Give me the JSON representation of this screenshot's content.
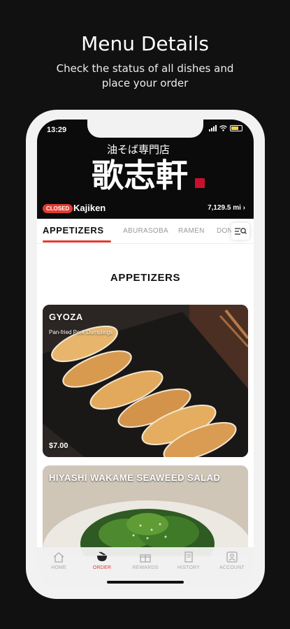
{
  "promo": {
    "title": "Menu Details",
    "subtitle": "Check the status of all dishes and place your order"
  },
  "status_bar": {
    "time": "13:29",
    "battery_color": "#f5d442"
  },
  "store": {
    "status_badge": "CLOSED",
    "name": "Kajiken",
    "distance": "7,129.5 mi"
  },
  "categories": {
    "tabs": [
      "APPETIZERS",
      "ABURASOBA",
      "RAMEN",
      "DON"
    ],
    "active_index": 0
  },
  "section": {
    "title": "APPETIZERS"
  },
  "menu_items": [
    {
      "name": "GYOZA",
      "description": "Pan-fried Pork Dumplings",
      "price": "$7.00"
    },
    {
      "name": "HIYASHI WAKAME SEAWEED SALAD"
    }
  ],
  "bottom_nav": {
    "items": [
      "HOME",
      "ORDER",
      "REWARDS",
      "HISTORY",
      "ACCOUNT"
    ],
    "active_index": 1
  },
  "colors": {
    "accent": "#e53a2e",
    "header_bg": "#0b0b0b",
    "page_bg": "#111111"
  }
}
